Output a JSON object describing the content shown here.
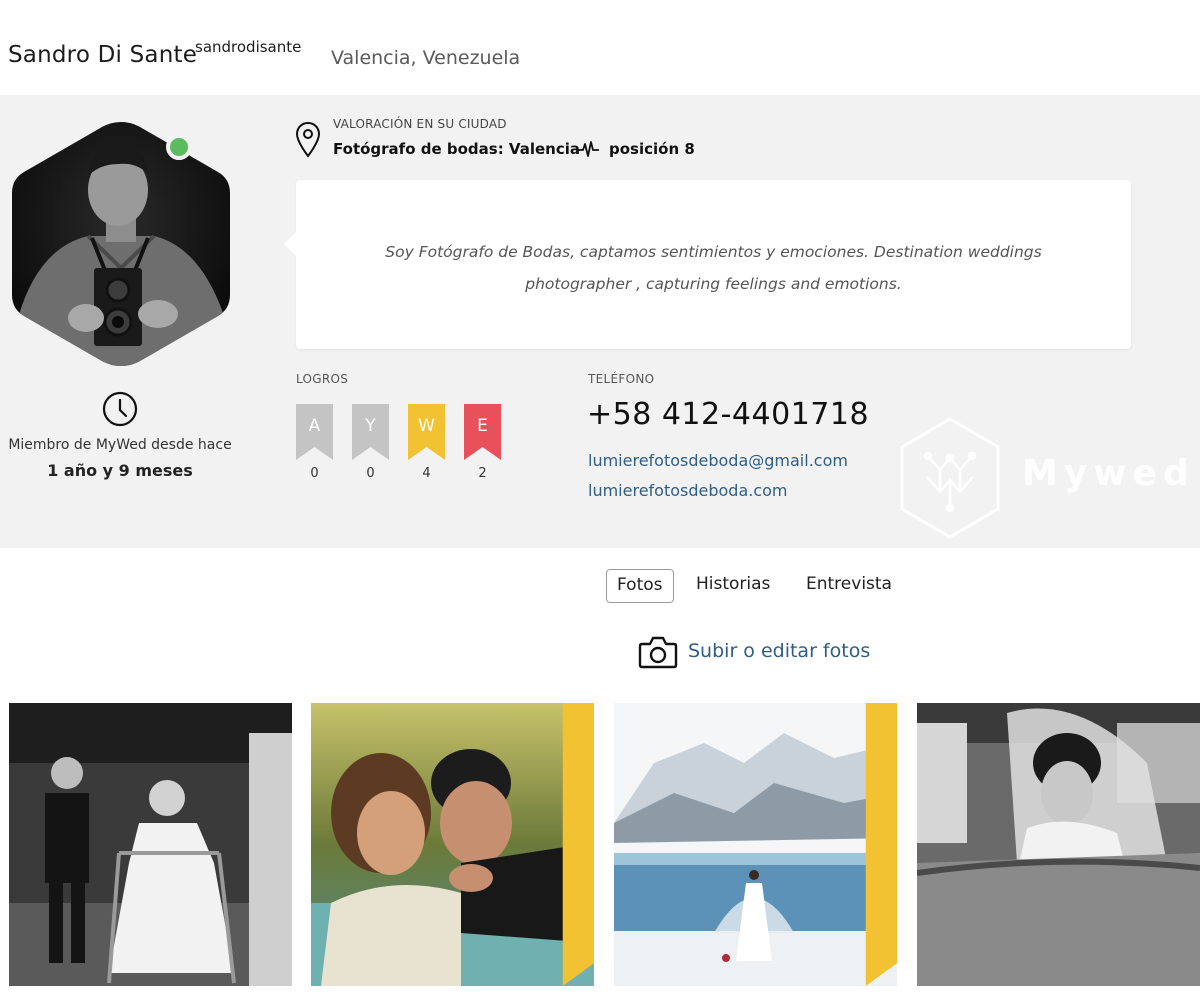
{
  "profile": {
    "name": "Sandro Di Sante",
    "username": "sandrodisante",
    "location": "Valencia, Venezuela",
    "online": true,
    "member_since_label": "Miembro de MyWed desde hace",
    "member_duration": "1 año y 9 meses"
  },
  "rating": {
    "label": "VALORACIÓN EN SU CIUDAD",
    "category": "Fotógrafo de bodas: Valencia",
    "position": "posición 8"
  },
  "bio": "Soy Fotógrafo de Bodas, captamos sentimientos y emociones. Destination weddings photographer , capturing feelings and emotions.",
  "achievements": {
    "label": "LOGROS",
    "badges": [
      {
        "letter": "A",
        "count": "0",
        "color": "#c4c4c4"
      },
      {
        "letter": "Y",
        "count": "0",
        "color": "#c4c4c4"
      },
      {
        "letter": "W",
        "count": "4",
        "color": "#f2c232"
      },
      {
        "letter": "E",
        "count": "2",
        "color": "#e8505b"
      }
    ]
  },
  "contact": {
    "phone_label": "TELÉFONO",
    "phone": "+58 412-4401718",
    "email": "lumierefotosdeboda@gmail.com",
    "website": "lumierefotosdeboda.com"
  },
  "watermark": {
    "text": "Mywed",
    "icon": "mywed-hex-logo-icon"
  },
  "tabs": [
    {
      "label": "Fotos",
      "active": true
    },
    {
      "label": "Historias",
      "active": false
    },
    {
      "label": "Entrevista",
      "active": false
    }
  ],
  "upload": {
    "label": "Subir o editar fotos",
    "icon": "camera-icon"
  },
  "photos": [
    {
      "subject": "Niña con andador",
      "ribbons": [
        "#f2c232"
      ]
    },
    {
      "subject": "Pareja abrazada",
      "ribbons": [
        "#f2c232",
        "#e8505b"
      ]
    },
    {
      "subject": "Novia en la nieve",
      "ribbons": [
        "#f2c232",
        "#e8505b"
      ]
    },
    {
      "subject": "Novia en el auto",
      "ribbons": [
        "#f2c232"
      ]
    }
  ],
  "colors": {
    "band": "#f2f2f2",
    "link": "#2f5d86",
    "online": "#5cba5f",
    "badge_gold": "#f2c232",
    "badge_red": "#e8505b",
    "badge_gray": "#c4c4c4"
  }
}
